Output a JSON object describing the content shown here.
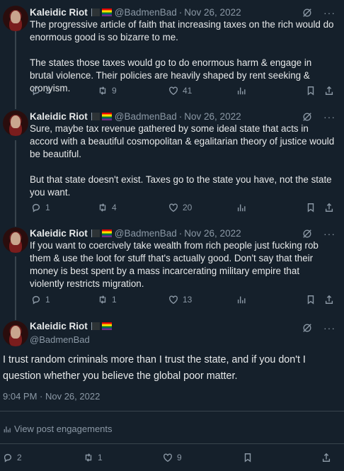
{
  "tweets": [
    {
      "name": "Kaleidic Riot",
      "handle": "@BadmenBad",
      "date": "Nov 26, 2022",
      "paragraphs": [
        "The progressive article of faith that increasing taxes on the rich would do enormous good is so bizarre to me.",
        "The states those taxes would go to do enormous harm & engage in brutal violence. Their policies are heavily shaped by rent seeking & cronyism."
      ],
      "replies": "3",
      "reposts": "9",
      "likes": "41"
    },
    {
      "name": "Kaleidic Riot",
      "handle": "@BadmenBad",
      "date": "Nov 26, 2022",
      "paragraphs": [
        "Sure, maybe tax revenue gathered by some ideal state that acts in accord with a beautiful cosmopolitan & egalitarian theory of justice would be beautiful.",
        "But that state doesn't exist. Taxes go to the state you have, not the state you want."
      ],
      "replies": "1",
      "reposts": "4",
      "likes": "20"
    },
    {
      "name": "Kaleidic Riot",
      "handle": "@BadmenBad",
      "date": "Nov 26, 2022",
      "paragraphs": [
        "If you want to coercively take wealth from rich people just fucking rob them & use the loot for stuff that's actually good. Don't say that their money is best spent by a mass incarcerating military empire that violently restricts migration."
      ],
      "replies": "1",
      "reposts": "1",
      "likes": "13"
    }
  ],
  "focus": {
    "name": "Kaleidic Riot",
    "handle": "@BadmenBad",
    "text": "I trust random criminals more than I trust the state, and if you don't I question whether you believe the global poor matter.",
    "timestamp": "9:04 PM · Nov 26, 2022",
    "engagements_label": "View post engagements",
    "replies": "2",
    "reposts": "1",
    "likes": "9"
  },
  "colors": {
    "background": "#15202b",
    "text": "#e7e9ea",
    "muted": "#8b98a5",
    "divider": "#38444d"
  }
}
